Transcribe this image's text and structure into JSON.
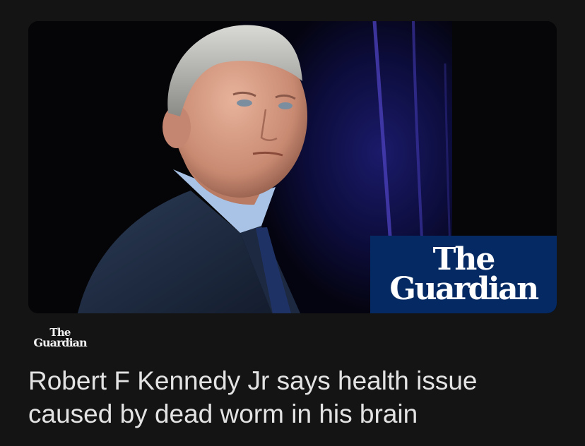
{
  "article": {
    "image_alt_icon": "article-photo",
    "image_badge": {
      "line1": "The",
      "line2": "Guardian"
    },
    "source": {
      "line1": "The",
      "line2": "Guardian"
    },
    "headline": "Robert F Kennedy Jr says health issue caused by dead worm in his brain"
  },
  "colors": {
    "background": "#141414",
    "guardian_blue": "#052962",
    "headline_text": "#e3e3e3"
  }
}
